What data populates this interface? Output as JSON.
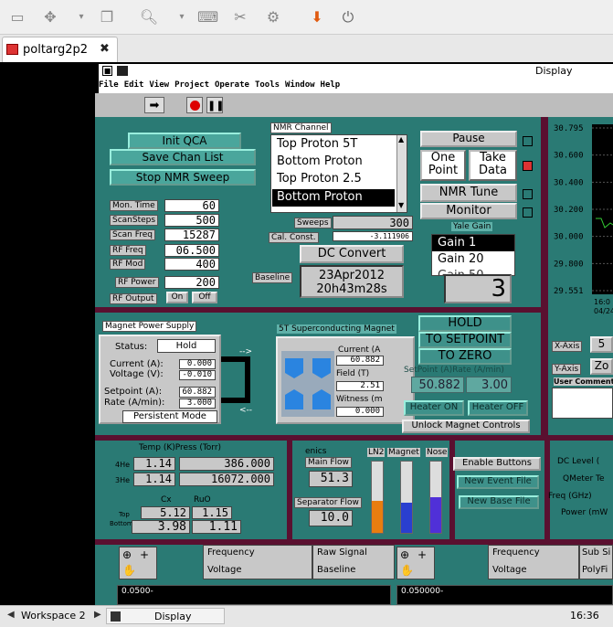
{
  "tab": {
    "title": "poltarg2p2",
    "close": "✖"
  },
  "app": {
    "window_title": "Display",
    "menu": [
      "File",
      "Edit",
      "View",
      "Project",
      "Operate",
      "Tools",
      "Window",
      "Help"
    ]
  },
  "left_block": {
    "init_qca": "Init QCA",
    "save_chan_list": "Save Chan List",
    "stop_nmr_sweep": "Stop NMR Sweep",
    "rows": [
      {
        "label": "Mon. Time",
        "value": "60"
      },
      {
        "label": "ScanSteps",
        "value": "500"
      },
      {
        "label": "Scan Freq",
        "value": "15287"
      },
      {
        "label": "RF Freq",
        "value": "06.500"
      },
      {
        "label": "RF Mod",
        "value": "400"
      },
      {
        "label": "RF Power",
        "value": "200"
      }
    ],
    "rf_output": {
      "label": "RF Output",
      "on": "On",
      "off": "Off"
    }
  },
  "nmr": {
    "channel_label": "NMR Channel",
    "channels": [
      "Top Proton 5T",
      "Bottom Proton",
      "Top Proton 2.5",
      "Bottom Proton"
    ],
    "sweeps_label": "Sweeps",
    "sweeps_value": "300",
    "cal_const_label": "Cal. Const.",
    "cal_const_value": "-3.111906",
    "dc_convert": "DC Convert",
    "baseline_label": "Baseline",
    "baseline_date": "23Apr2012",
    "baseline_time": "20h43m28s"
  },
  "controls": {
    "pause": "Pause",
    "one_point": "One Point",
    "take_data": "Take Data",
    "nmr_tune": "NMR Tune",
    "monitor": "Monitor",
    "yale_gain": "Yale Gain",
    "gains": [
      "Gain 1",
      "Gain 20",
      "Gain 50"
    ],
    "gain_display": "3"
  },
  "chart_data": {
    "type": "line",
    "tick_labels": [
      "30.795",
      "30.600",
      "30.400",
      "30.200",
      "30.000",
      "29.800",
      "29.551"
    ],
    "bottom_labels": [
      "16:0",
      "04/24/"
    ],
    "xaxis_label": "X-Axis",
    "xaxis_value": "5",
    "yaxis_label": "Y-Axis",
    "yaxis_value": "Zo",
    "user_comment": "User Comment"
  },
  "magnet": {
    "title": "Magnet Power Supply",
    "status_label": "Status:",
    "status_value": "Hold",
    "current_label": "Current (A):",
    "current_value": "0.000",
    "voltage_label": "Voltage (V):",
    "voltage_value": "-0.010",
    "setpoint_label": "Setpoint (A):",
    "setpoint_value": "60.882",
    "rate_label": "Rate (A/min):",
    "rate_value": "3.000",
    "persistent": "Persistent Mode",
    "arrow_top": "-->",
    "arrow_bottom": "<--"
  },
  "sc_magnet": {
    "title": "5T Superconducting Magnet",
    "current_label": "Current (A",
    "current_value": "60.882",
    "field_label": "Field (T)",
    "field_value": "2.51",
    "witness_label": "Witness (m",
    "witness_value": "0.000",
    "hold": "HOLD",
    "to_setpoint": "TO SETPOINT",
    "to_zero": "TO ZERO",
    "setpoint_label": "SetPoint (A)Rate (A/min)",
    "setpoint_value": "50.882",
    "rate_value": "3.00",
    "heater_on": "Heater ON",
    "heater_off": "Heater OFF",
    "unlock": "Unlock Magnet Controls"
  },
  "temp": {
    "title": "Temp (K)Press (Torr)",
    "he4_label": "4He",
    "he4_temp": "1.14",
    "he4_press": "386.000",
    "he3_label": "3He",
    "he3_temp": "1.14",
    "he3_press": "16072.000",
    "cx_label": "Cx",
    "ruo_label": "RuO",
    "top_label": "Top",
    "top_cx": "5.12",
    "top_ruo": "1.15",
    "bottom_label": "Bottom",
    "bottom_cx": "3.98",
    "bottom_ruo": "1.11"
  },
  "flow": {
    "cut_label": "enics",
    "main_flow_label": "Main Flow",
    "main_flow_value": "51.3",
    "sep_flow_label": "Separator Flow",
    "sep_flow_value": "10.0",
    "tanks": [
      {
        "label": "LN2",
        "level": 0.45,
        "color": "#e87d10"
      },
      {
        "label": "Magnet",
        "level": 0.42,
        "color": "#2a3fd0"
      },
      {
        "label": "Nose",
        "level": 0.5,
        "color": "#5030d8"
      }
    ]
  },
  "files": {
    "enable": "Enable Buttons",
    "new_event": "New Event File",
    "new_base": "New Base File"
  },
  "right_params": {
    "dc_level": "DC Level (",
    "qmeter": "QMeter Te",
    "freq": "Freq (GHz)",
    "power": "Power (mW"
  },
  "bottom_strip": {
    "frequency": "Frequency",
    "voltage": "Voltage",
    "raw_signal": "Raw Signal",
    "baseline": "Baseline",
    "sub_sig": "Sub Si",
    "polyfit": "PolyFi",
    "scale_left": "0.0500-",
    "scale_right": "0.050000-"
  },
  "taskbar": {
    "workspace": "Workspace 2",
    "display": "Display",
    "clock": "16:36"
  }
}
